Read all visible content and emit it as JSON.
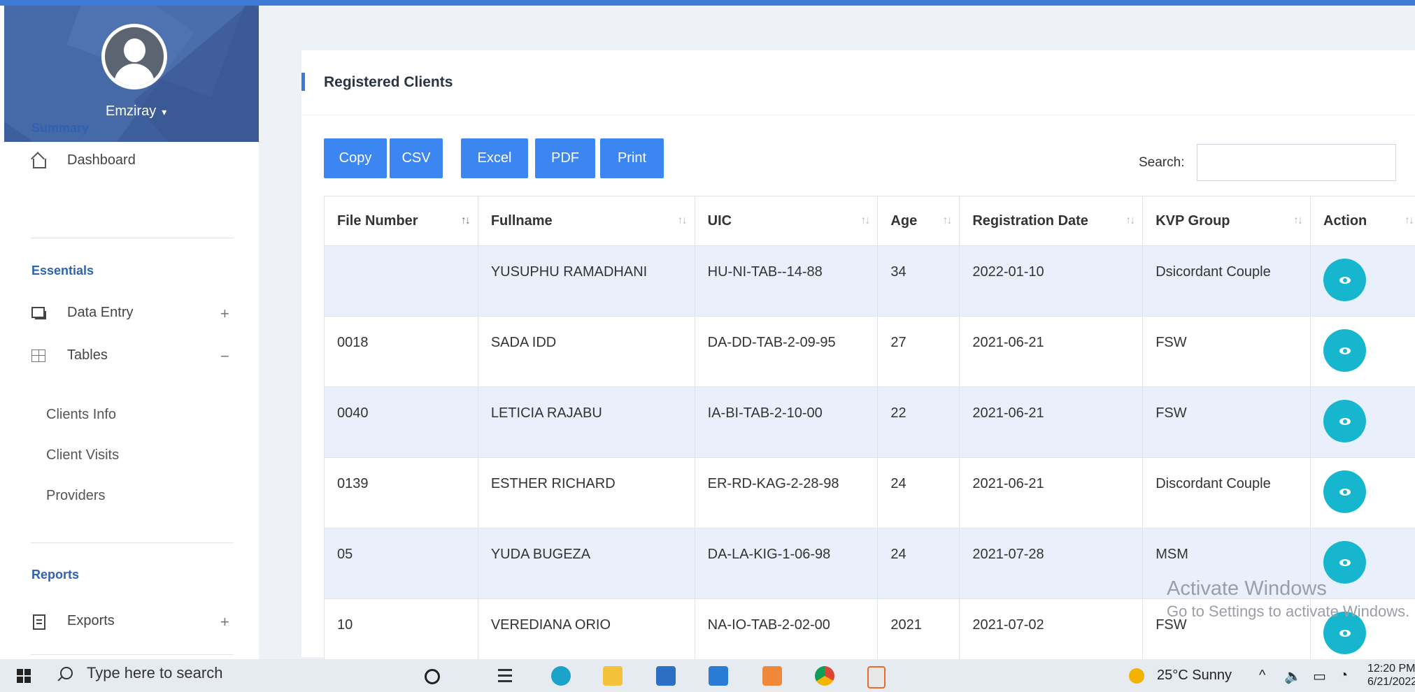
{
  "sidebar": {
    "username": "Emziray",
    "sections": {
      "summary": "Summary",
      "essentials": "Essentials",
      "reports": "Reports"
    },
    "items": {
      "dashboard": "Dashboard",
      "data_entry": "Data Entry",
      "tables": "Tables",
      "exports": "Exports"
    },
    "toggles": {
      "data_entry": "+",
      "tables": "−",
      "exports": "+"
    },
    "sub_items": [
      "Clients Info",
      "Client Visits",
      "Providers"
    ]
  },
  "main": {
    "title": "Registered Clients",
    "buttons": [
      "Copy",
      "CSV",
      "Excel",
      "PDF",
      "Print"
    ],
    "search_label": "Search:",
    "search_value": "",
    "columns": [
      "File Number",
      "Fullname",
      "UIC",
      "Age",
      "Registration Date",
      "KVP Group",
      "Action"
    ],
    "rows": [
      [
        "",
        "YUSUPHU RAMADHANI",
        "HU-NI-TAB--14-88",
        "34",
        "2022-01-10",
        "Dsicordant Couple"
      ],
      [
        "0018",
        "SADA IDD",
        "DA-DD-TAB-2-09-95",
        "27",
        "2021-06-21",
        "FSW"
      ],
      [
        "0040",
        "LETICIA RAJABU",
        "IA-BI-TAB-2-10-00",
        "22",
        "2021-06-21",
        "FSW"
      ],
      [
        "0139",
        "ESTHER RICHARD",
        "ER-RD-KAG-2-28-98",
        "24",
        "2021-06-21",
        "Discordant Couple"
      ],
      [
        "05",
        "YUDA BUGEZA",
        "DA-LA-KIG-1-06-98",
        "24",
        "2021-07-28",
        "MSM"
      ],
      [
        "10",
        "VEREDIANA ORIO",
        "NA-IO-TAB-2-02-00",
        "2021",
        "2021-07-02",
        "FSW"
      ]
    ],
    "sort_icon": "sort-arrows-icon",
    "action_icon": "eye-icon",
    "colors": {
      "accent": "#3c86f2",
      "action": "#17b6cf",
      "row_alt": "#eaf0fb",
      "profile_bg": "#3d5f9e"
    }
  },
  "watermark": {
    "line1": "Activate Windows",
    "line2": "Go to Settings to activate Windows."
  },
  "taskbar": {
    "search_placeholder": "Type here to search",
    "weather": "25°C  Sunny",
    "time": "12:20 PM",
    "date": "6/21/2022"
  }
}
